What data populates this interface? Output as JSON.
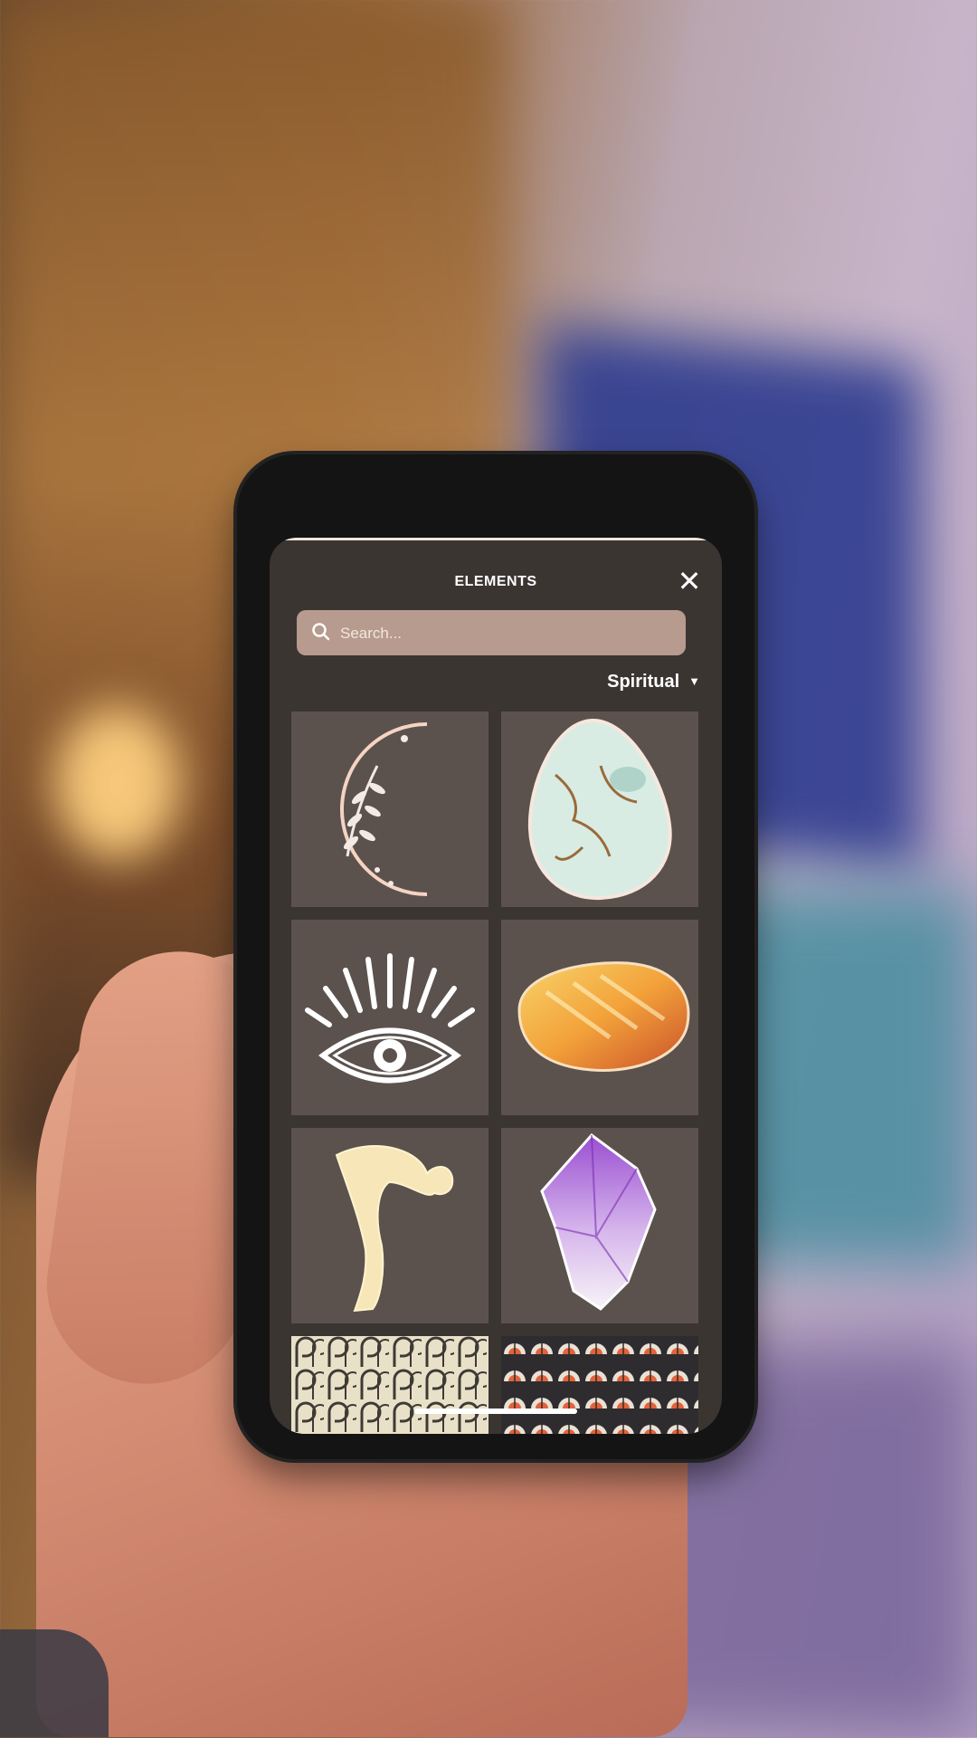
{
  "panel": {
    "title": "ELEMENTS",
    "close_icon": "close-icon",
    "search": {
      "placeholder": "Search...",
      "value": ""
    },
    "filter": {
      "label": "Spiritual",
      "icon": "caret-down-icon"
    }
  },
  "elements": [
    {
      "name": "crescent-moon-element",
      "icon": "moon-icon"
    },
    {
      "name": "agate-stone-element",
      "icon": "stone-icon"
    },
    {
      "name": "eye-element",
      "icon": "eye-icon"
    },
    {
      "name": "amber-stone-element",
      "icon": "stone-icon"
    },
    {
      "name": "yoga-pose-element",
      "icon": "figure-icon"
    },
    {
      "name": "amethyst-crystal-element",
      "icon": "crystal-icon"
    },
    {
      "name": "pattern-loops-element",
      "icon": "pattern-icon"
    },
    {
      "name": "pattern-fans-element",
      "icon": "pattern-icon"
    }
  ],
  "colors": {
    "panel_bg": "#3b3532",
    "tile_bg": "#5b524d",
    "search_bg": "#b79b8e",
    "accent_text": "#ffffff"
  }
}
